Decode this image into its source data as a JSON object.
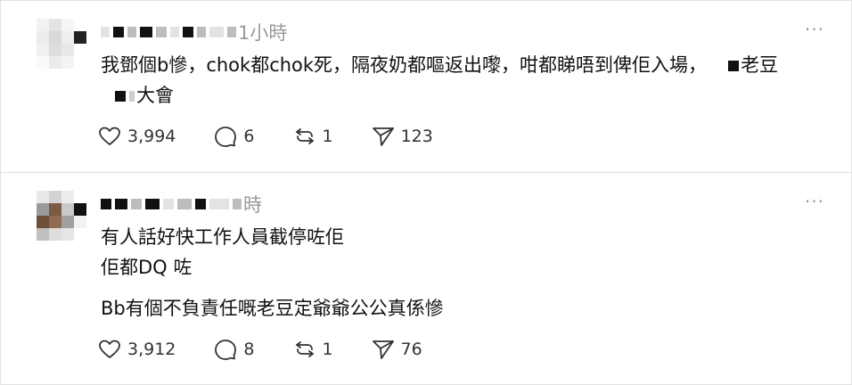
{
  "posts": [
    {
      "time": "1小時",
      "lines": [
        "我鄧個b慘，chok都chok死，隔夜奶都嘔返出嚟，咁都睇唔到俾佢入場，",
        "老豆",
        "大會"
      ],
      "likes": "3,994",
      "replies": "6",
      "reposts": "1",
      "shares": "123",
      "more": "···"
    },
    {
      "time": "時",
      "lines": [
        "有人話好快工作人員截停咗佢",
        "佢都DQ 咗",
        "Bb有個不負責任嘅老豆定爺爺公公真係慘"
      ],
      "likes": "3,912",
      "replies": "8",
      "reposts": "1",
      "shares": "76",
      "more": "···"
    }
  ],
  "icons": {
    "like": "heart-icon",
    "reply": "comment-bubble-icon",
    "repost": "repost-icon",
    "share": "send-icon",
    "more": "more-dots-icon"
  }
}
